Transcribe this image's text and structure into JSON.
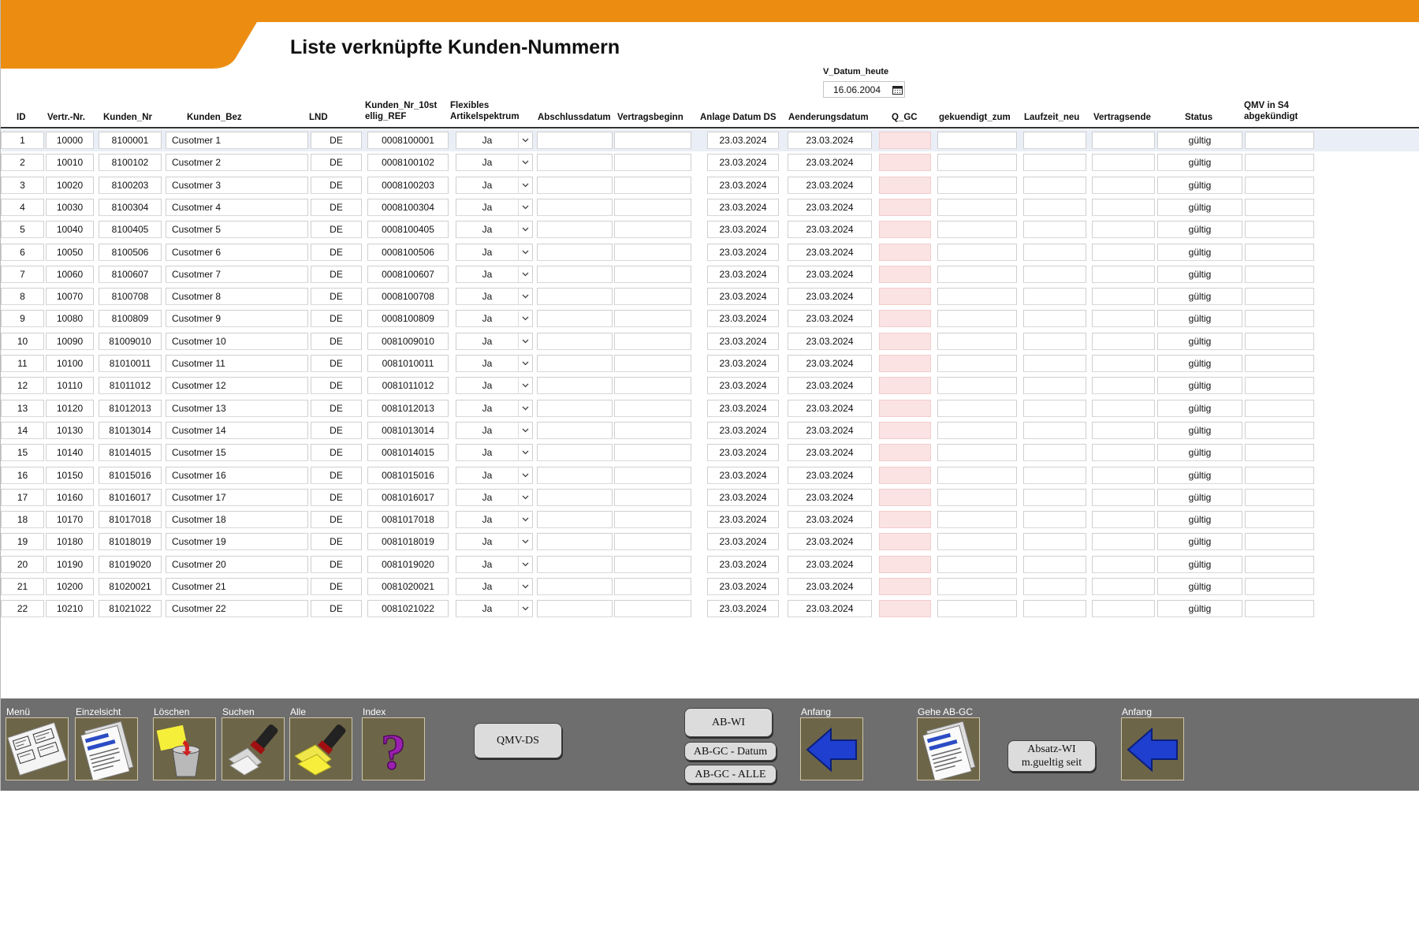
{
  "page_title": "Liste verknüpfte Kunden-Nummern",
  "v_datum": {
    "label": "V_Datum_heute",
    "value": "16.06.2004",
    "icon": "calendar-icon"
  },
  "columns": [
    [
      "ID"
    ],
    [
      "Vertr.-Nr."
    ],
    [
      "Kunden_Nr"
    ],
    [
      "Kunden_Bez"
    ],
    [
      "LND"
    ],
    [
      "Kunden_Nr_10st",
      "ellig_REF"
    ],
    [
      "Flexibles",
      "Artikelspektrum"
    ],
    [
      "Abschlussdatum"
    ],
    [
      "Vertragsbeginn"
    ],
    [
      "Anlage Datum DS"
    ],
    [
      "Aenderungsdatum"
    ],
    [
      "Q_GC"
    ],
    [
      "gekuendigt_zum"
    ],
    [
      "Laufzeit_neu"
    ],
    [
      "Vertragsende"
    ],
    [
      "Status"
    ],
    [
      "QMV in S4",
      "abgekündigt"
    ]
  ],
  "rows": [
    {
      "id": "1",
      "vertr": "10000",
      "kunden_nr": "8100001",
      "bez": "Cusotmer 1",
      "lnd": "DE",
      "ref": "0008100001",
      "flex": "Ja",
      "anlage": "23.03.2024",
      "aend": "23.03.2024",
      "status": "gültig"
    },
    {
      "id": "2",
      "vertr": "10010",
      "kunden_nr": "8100102",
      "bez": "Cusotmer 2",
      "lnd": "DE",
      "ref": "0008100102",
      "flex": "Ja",
      "anlage": "23.03.2024",
      "aend": "23.03.2024",
      "status": "gültig"
    },
    {
      "id": "3",
      "vertr": "10020",
      "kunden_nr": "8100203",
      "bez": "Cusotmer 3",
      "lnd": "DE",
      "ref": "0008100203",
      "flex": "Ja",
      "anlage": "23.03.2024",
      "aend": "23.03.2024",
      "status": "gültig"
    },
    {
      "id": "4",
      "vertr": "10030",
      "kunden_nr": "8100304",
      "bez": "Cusotmer 4",
      "lnd": "DE",
      "ref": "0008100304",
      "flex": "Ja",
      "anlage": "23.03.2024",
      "aend": "23.03.2024",
      "status": "gültig"
    },
    {
      "id": "5",
      "vertr": "10040",
      "kunden_nr": "8100405",
      "bez": "Cusotmer 5",
      "lnd": "DE",
      "ref": "0008100405",
      "flex": "Ja",
      "anlage": "23.03.2024",
      "aend": "23.03.2024",
      "status": "gültig"
    },
    {
      "id": "6",
      "vertr": "10050",
      "kunden_nr": "8100506",
      "bez": "Cusotmer 6",
      "lnd": "DE",
      "ref": "0008100506",
      "flex": "Ja",
      "anlage": "23.03.2024",
      "aend": "23.03.2024",
      "status": "gültig"
    },
    {
      "id": "7",
      "vertr": "10060",
      "kunden_nr": "8100607",
      "bez": "Cusotmer 7",
      "lnd": "DE",
      "ref": "0008100607",
      "flex": "Ja",
      "anlage": "23.03.2024",
      "aend": "23.03.2024",
      "status": "gültig"
    },
    {
      "id": "8",
      "vertr": "10070",
      "kunden_nr": "8100708",
      "bez": "Cusotmer 8",
      "lnd": "DE",
      "ref": "0008100708",
      "flex": "Ja",
      "anlage": "23.03.2024",
      "aend": "23.03.2024",
      "status": "gültig"
    },
    {
      "id": "9",
      "vertr": "10080",
      "kunden_nr": "8100809",
      "bez": "Cusotmer 9",
      "lnd": "DE",
      "ref": "0008100809",
      "flex": "Ja",
      "anlage": "23.03.2024",
      "aend": "23.03.2024",
      "status": "gültig"
    },
    {
      "id": "10",
      "vertr": "10090",
      "kunden_nr": "81009010",
      "bez": "Cusotmer 10",
      "lnd": "DE",
      "ref": "0081009010",
      "flex": "Ja",
      "anlage": "23.03.2024",
      "aend": "23.03.2024",
      "status": "gültig"
    },
    {
      "id": "11",
      "vertr": "10100",
      "kunden_nr": "81010011",
      "bez": "Cusotmer 11",
      "lnd": "DE",
      "ref": "0081010011",
      "flex": "Ja",
      "anlage": "23.03.2024",
      "aend": "23.03.2024",
      "status": "gültig"
    },
    {
      "id": "12",
      "vertr": "10110",
      "kunden_nr": "81011012",
      "bez": "Cusotmer 12",
      "lnd": "DE",
      "ref": "0081011012",
      "flex": "Ja",
      "anlage": "23.03.2024",
      "aend": "23.03.2024",
      "status": "gültig"
    },
    {
      "id": "13",
      "vertr": "10120",
      "kunden_nr": "81012013",
      "bez": "Cusotmer 13",
      "lnd": "DE",
      "ref": "0081012013",
      "flex": "Ja",
      "anlage": "23.03.2024",
      "aend": "23.03.2024",
      "status": "gültig"
    },
    {
      "id": "14",
      "vertr": "10130",
      "kunden_nr": "81013014",
      "bez": "Cusotmer 14",
      "lnd": "DE",
      "ref": "0081013014",
      "flex": "Ja",
      "anlage": "23.03.2024",
      "aend": "23.03.2024",
      "status": "gültig"
    },
    {
      "id": "15",
      "vertr": "10140",
      "kunden_nr": "81014015",
      "bez": "Cusotmer 15",
      "lnd": "DE",
      "ref": "0081014015",
      "flex": "Ja",
      "anlage": "23.03.2024",
      "aend": "23.03.2024",
      "status": "gültig"
    },
    {
      "id": "16",
      "vertr": "10150",
      "kunden_nr": "81015016",
      "bez": "Cusotmer 16",
      "lnd": "DE",
      "ref": "0081015016",
      "flex": "Ja",
      "anlage": "23.03.2024",
      "aend": "23.03.2024",
      "status": "gültig"
    },
    {
      "id": "17",
      "vertr": "10160",
      "kunden_nr": "81016017",
      "bez": "Cusotmer 17",
      "lnd": "DE",
      "ref": "0081016017",
      "flex": "Ja",
      "anlage": "23.03.2024",
      "aend": "23.03.2024",
      "status": "gültig"
    },
    {
      "id": "18",
      "vertr": "10170",
      "kunden_nr": "81017018",
      "bez": "Cusotmer 18",
      "lnd": "DE",
      "ref": "0081017018",
      "flex": "Ja",
      "anlage": "23.03.2024",
      "aend": "23.03.2024",
      "status": "gültig"
    },
    {
      "id": "19",
      "vertr": "10180",
      "kunden_nr": "81018019",
      "bez": "Cusotmer 19",
      "lnd": "DE",
      "ref": "0081018019",
      "flex": "Ja",
      "anlage": "23.03.2024",
      "aend": "23.03.2024",
      "status": "gültig"
    },
    {
      "id": "20",
      "vertr": "10190",
      "kunden_nr": "81019020",
      "bez": "Cusotmer 20",
      "lnd": "DE",
      "ref": "0081019020",
      "flex": "Ja",
      "anlage": "23.03.2024",
      "aend": "23.03.2024",
      "status": "gültig"
    },
    {
      "id": "21",
      "vertr": "10200",
      "kunden_nr": "81020021",
      "bez": "Cusotmer 21",
      "lnd": "DE",
      "ref": "0081020021",
      "flex": "Ja",
      "anlage": "23.03.2024",
      "aend": "23.03.2024",
      "status": "gültig"
    },
    {
      "id": "22",
      "vertr": "10210",
      "kunden_nr": "81021022",
      "bez": "Cusotmer 22",
      "lnd": "DE",
      "ref": "0081021022",
      "flex": "Ja",
      "anlage": "23.03.2024",
      "aend": "23.03.2024",
      "status": "gültig"
    }
  ],
  "toolbar": {
    "tools": [
      {
        "label": "Menü",
        "icon": "menu-forms-icon"
      },
      {
        "label": "Einzelsicht",
        "icon": "document-icon"
      },
      {
        "label": "Löschen",
        "icon": "trash-icon"
      },
      {
        "label": "Suchen",
        "icon": "search-flashlight-icon"
      },
      {
        "label": "Alle",
        "icon": "all-flashlight-icon"
      },
      {
        "label": "Index",
        "icon": "question-mark-icon"
      },
      {
        "label": "Anfang",
        "icon": "arrow-left-icon"
      },
      {
        "label": "Gehe AB-GC",
        "icon": "document-icon"
      },
      {
        "label": "Anfang",
        "icon": "arrow-left-icon"
      }
    ],
    "qmv_ds": "QMV-DS",
    "ab_wi": "AB-WI",
    "ab_gc_datum": "AB-GC - Datum",
    "ab_gc_alle": "AB-GC - ALLE",
    "absatz_wi_line1": "Absatz-WI",
    "absatz_wi_line2": "m.gueltig seit"
  },
  "colors": {
    "accent": "#ec8d12",
    "toolbar_bg": "#6e6e6e",
    "qgc_pink": "#fbe3e3",
    "selected_row": "#eaeef6"
  }
}
